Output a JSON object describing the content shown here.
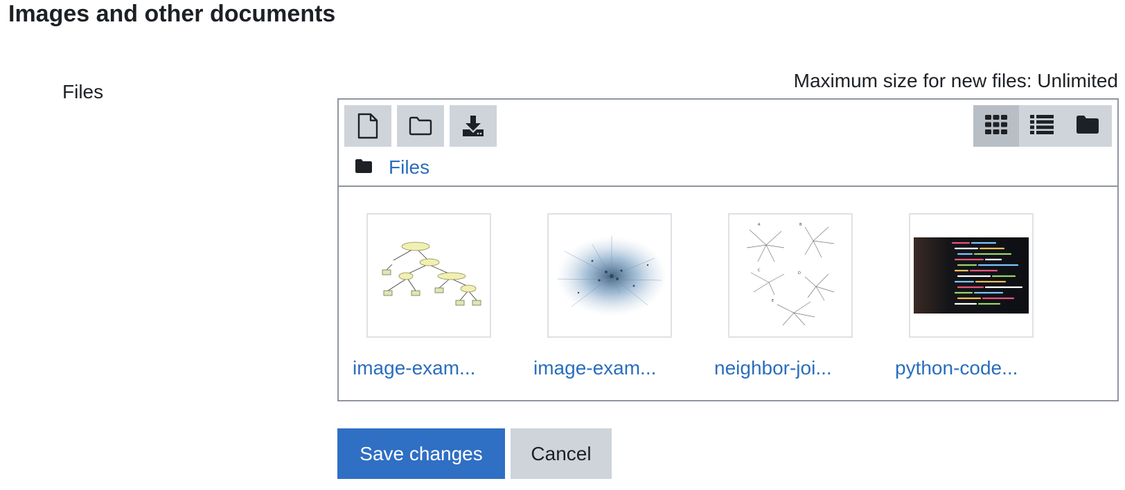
{
  "section": {
    "title": "Images and other documents"
  },
  "field": {
    "label": "Files"
  },
  "filemanager": {
    "max_size_text": "Maximum size for new files: Unlimited",
    "toolbar": {
      "buttons": [
        {
          "icon": "file-icon"
        },
        {
          "icon": "folder-icon"
        },
        {
          "icon": "download-icon"
        }
      ],
      "view_modes": [
        {
          "icon": "grid-view-icon",
          "active": true
        },
        {
          "icon": "list-view-icon",
          "active": false
        },
        {
          "icon": "tree-view-folder-icon",
          "active": false
        }
      ]
    },
    "path": {
      "label": "Files"
    },
    "files": [
      {
        "name": "image-exam...",
        "thumbnail": "tree-diagram"
      },
      {
        "name": "image-exam...",
        "thumbnail": "network-graph"
      },
      {
        "name": "neighbor-joi...",
        "thumbnail": "star-trees"
      },
      {
        "name": "python-code...",
        "thumbnail": "code-screen"
      }
    ]
  },
  "actions": {
    "save_label": "Save changes",
    "cancel_label": "Cancel"
  },
  "colors": {
    "link": "#2a6ebd",
    "primary": "#2f6fc4",
    "secondary": "#ced4da",
    "border": "#8f959e"
  }
}
